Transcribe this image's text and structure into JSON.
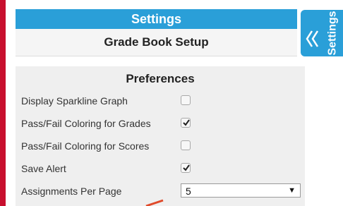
{
  "header": {
    "title": "Settings"
  },
  "subheader": {
    "title": "Grade Book Setup"
  },
  "side_tab": {
    "label": "Settings"
  },
  "preferences": {
    "title": "Preferences",
    "items": [
      {
        "label": "Display Sparkline Graph",
        "checked": false
      },
      {
        "label": "Pass/Fail Coloring for Grades",
        "checked": true
      },
      {
        "label": "Pass/Fail Coloring for Scores",
        "checked": false
      },
      {
        "label": "Save Alert",
        "checked": true
      }
    ],
    "assignments_per_page": {
      "label": "Assignments Per Page",
      "value": "5"
    }
  },
  "colors": {
    "header": "#2a9fd8",
    "accent_bar": "#c8102e",
    "panel": "#efefef"
  }
}
